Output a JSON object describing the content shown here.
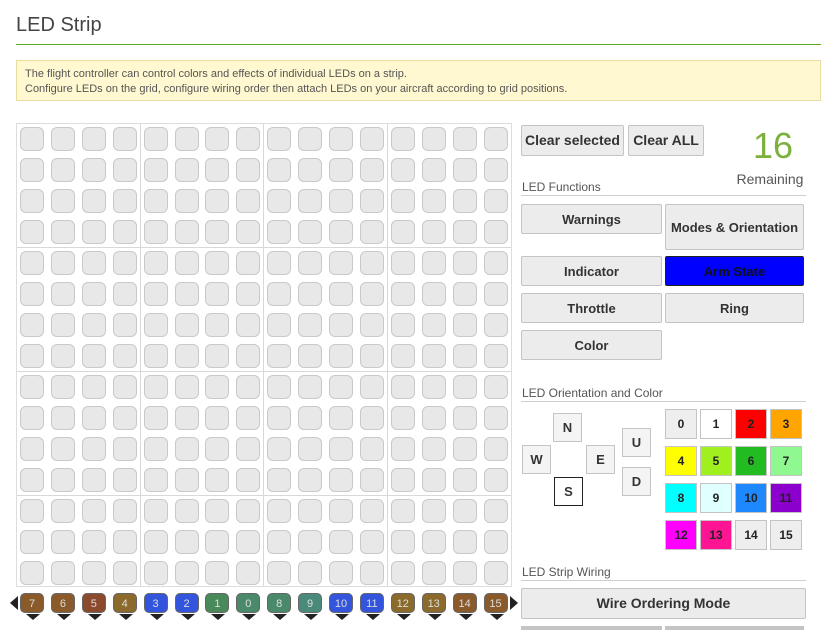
{
  "header": {
    "title": "LED Strip"
  },
  "note": {
    "line1": "The flight controller can control colors and effects of individual LEDs on a strip.",
    "line2": "Configure LEDs on the grid, configure wiring order then attach LEDs on your aircraft according to grid positions."
  },
  "grid": {
    "columns": 16,
    "rows": 15
  },
  "wiring_strip": {
    "leds": [
      {
        "label": "7",
        "color": "#8b5a2b"
      },
      {
        "label": "6",
        "color": "#8b5a2b"
      },
      {
        "label": "5",
        "color": "#8b4a2b"
      },
      {
        "label": "4",
        "color": "#8b6a2b"
      },
      {
        "label": "3",
        "color": "#3355dd"
      },
      {
        "label": "2",
        "color": "#3355dd"
      },
      {
        "label": "1",
        "color": "#4a8a5a"
      },
      {
        "label": "0",
        "color": "#4a8a6a"
      },
      {
        "label": "8",
        "color": "#4a8a6a"
      },
      {
        "label": "9",
        "color": "#4a8a7a"
      },
      {
        "label": "10",
        "color": "#3355dd"
      },
      {
        "label": "11",
        "color": "#3355dd"
      },
      {
        "label": "12",
        "color": "#8b6a2b"
      },
      {
        "label": "13",
        "color": "#8b6a2b"
      },
      {
        "label": "14",
        "color": "#8b5a2b"
      },
      {
        "label": "15",
        "color": "#8b5a2b"
      }
    ]
  },
  "actions": {
    "clear_selected": "Clear selected",
    "clear_all": "Clear ALL"
  },
  "remaining": {
    "count": "16",
    "label": "Remaining"
  },
  "functions": {
    "heading": "LED Functions",
    "warnings": "Warnings",
    "modes": "Modes & Orientation",
    "indicator": "Indicator",
    "arm_state": "Arm State",
    "throttle": "Throttle",
    "ring": "Ring",
    "color": "Color",
    "arm_state_color": "#0000ff"
  },
  "orientation": {
    "heading": "LED Orientation and Color",
    "n": "N",
    "w": "W",
    "e": "E",
    "s": "S",
    "u": "U",
    "d": "D"
  },
  "colors": [
    {
      "label": "0",
      "bg": "#eeeeee"
    },
    {
      "label": "1",
      "bg": "#ffffff"
    },
    {
      "label": "2",
      "bg": "#ff0000"
    },
    {
      "label": "3",
      "bg": "#ffa500"
    },
    {
      "label": "4",
      "bg": "#ffff00"
    },
    {
      "label": "5",
      "bg": "#a0f020"
    },
    {
      "label": "6",
      "bg": "#22bb22"
    },
    {
      "label": "7",
      "bg": "#90f890"
    },
    {
      "label": "8",
      "bg": "#00ffff"
    },
    {
      "label": "9",
      "bg": "#e0ffff"
    },
    {
      "label": "10",
      "bg": "#1e88ff"
    },
    {
      "label": "11",
      "bg": "#8b00cc"
    },
    {
      "label": "12",
      "bg": "#ff00ff"
    },
    {
      "label": "13",
      "bg": "#ff1493"
    },
    {
      "label": "14",
      "bg": "#eeeeee"
    },
    {
      "label": "15",
      "bg": "#eeeeee"
    }
  ],
  "wiring": {
    "heading": "LED Strip Wiring",
    "mode_button": "Wire Ordering Mode"
  }
}
